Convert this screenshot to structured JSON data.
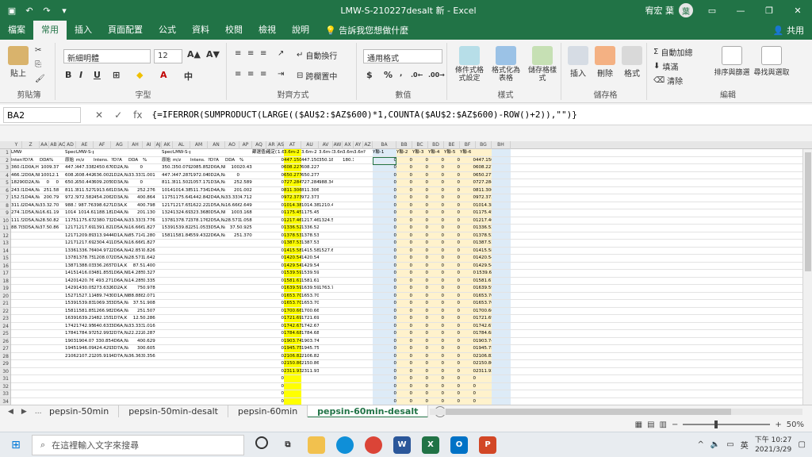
{
  "title_bar": {
    "document_title": "LMW-S-210227desalt 新 - Excel",
    "user_name": "宥宏 葉",
    "avatar_initial": "葉",
    "autosave_icon": "save-icon"
  },
  "menu": {
    "tabs": [
      "檔案",
      "常用",
      "插入",
      "頁面配置",
      "公式",
      "資料",
      "校閱",
      "檢視",
      "說明"
    ],
    "active_tab": "常用",
    "tell_me": "告訴我您想做什麼",
    "share": "共用"
  },
  "ribbon": {
    "clipboard": {
      "paste": "貼上",
      "label": "剪貼簿"
    },
    "font": {
      "name": "新細明體",
      "size": "12",
      "label": "字型",
      "bold": "B",
      "italic": "I",
      "underline": "U",
      "phonetic": "中"
    },
    "alignment": {
      "wrap": "自動換行",
      "merge": "跨欄置中",
      "label": "對齊方式"
    },
    "number": {
      "format": "通用格式",
      "label": "數值",
      "currency": "$",
      "percent": "%"
    },
    "styles": {
      "conditional": "條件式格式設定",
      "table": "格式化為表格",
      "cell_styles": "儲存格樣式",
      "label": "樣式"
    },
    "cells": {
      "insert": "插入",
      "delete": "刪除",
      "format": "格式",
      "label": "儲存格"
    },
    "editing": {
      "autosum": "自動加總",
      "fill": "填滿",
      "clear": "清除",
      "sort": "排序與篩選",
      "find": "尋找與選取",
      "label": "編輯"
    }
  },
  "formula_bar": {
    "name_box": "BA2",
    "formula": "{=IFERROR(SUMPRODUCT(LARGE(($AU$2:$AZ$600)*1,COUNTA($AU$2:$AZ$600)-ROW()+2)),\"\")}"
  },
  "columns": [
    "Y",
    "Z",
    "AA",
    "AB",
    "AC",
    "AD",
    "AE",
    "AF",
    "AG",
    "AH",
    "AI",
    "AJ",
    "AK",
    "AL",
    "AM",
    "AN",
    "AO",
    "AP",
    "AQ",
    "AR",
    "AS",
    "AT",
    "AU",
    "AV",
    "AW",
    "AX",
    "AY",
    "AZ",
    "BA",
    "BB",
    "BC",
    "BD",
    "BE",
    "BF",
    "BG",
    "BH"
  ],
  "rows": [
    [
      "LMW-S-pepsin-ReAD.B-60min-desalt-4",
      "",
      "",
      "",
      "",
      "Spectrum",
      "LMW-S-pepsin-ReAD.B-60min-desalt-5",
      "",
      "",
      "",
      "",
      "",
      "Spectrum",
      "LMW-S-pepsin-ReAD.B-60min-desalt-6",
      "",
      "",
      "",
      "",
      "篩選值(1=有)",
      "確定(1=有)",
      "1.6m",
      "3.6m-2",
      "3.6m-2",
      "3.6m-3",
      "3.6m-4",
      "3.6m-5",
      "3.6m-6",
      "?",
      "Y聯-1",
      "Y聯-2",
      "Y聯-3",
      "Y聯-4",
      "Y聯-5",
      "Y聯-6",
      ""
    ],
    [
      "Intens.",
      "?D?A",
      "DDA",
      "%",
      "",
      "原始",
      "m/z",
      "Intens.",
      "?D?A",
      "DDA",
      "%",
      "",
      "原始",
      "m/z",
      "Intens.",
      "?D?A",
      "DDA",
      "%",
      "",
      "",
      "0",
      "447.15053",
      "447.15053",
      "350.182",
      "",
      "180.13",
      "",
      "",
      "0",
      "0",
      "0",
      "0",
      "0",
      "0",
      "447.1505"
    ],
    [
      "360.051",
      "1D0A,H",
      "100",
      "9.37259",
      "",
      "447.159",
      "447.338",
      "2450.67",
      "0D2A,Na",
      "0",
      "",
      "",
      "350.182",
      "350.079",
      "2085.85",
      "2D0A,NH",
      "100",
      "20.4399",
      "",
      "",
      "0",
      "608.22734",
      "608.22734",
      "",
      "",
      "",
      "",
      "",
      "0",
      "0",
      "0",
      "0",
      "0",
      "0",
      "608.2273"
    ],
    [
      "466.141",
      "2D0A,NH",
      "100",
      "12.1863",
      "",
      "608.227",
      "608.442",
      "636.002",
      "1D2A,Na",
      "33.3333",
      "1.00124",
      "",
      "447.159",
      "447.287",
      "1972.04",
      "0D2A,Na",
      "0",
      "",
      "",
      "",
      "0",
      "650.27736",
      "650.27736",
      "",
      "",
      "",
      "",
      "",
      "0",
      "0",
      "0",
      "0",
      "0",
      "0",
      "650.2774"
    ],
    [
      "1829.85",
      "0D2A,Na",
      "0",
      "0",
      "",
      "650.277",
      "650.443",
      "609.205",
      "0D3A,Na",
      "0",
      "",
      "",
      "811.306",
      "811.502",
      "1057.17",
      "1D3A,Na",
      "25",
      "2.58989",
      "",
      "",
      "0",
      "727.28448",
      "727.28448",
      "988.348",
      "",
      "",
      "",
      "",
      "0",
      "0",
      "0",
      "0",
      "0",
      "0",
      "727.2845"
    ],
    [
      "243.997",
      "1D4A,Na",
      "25",
      "1.58789",
      "",
      "811.306",
      "811.527",
      "1913.66",
      "1D3A,Na",
      "25",
      "2.27691",
      "",
      "1014.38",
      "1014.38",
      "511.734",
      "1D4A,Na",
      "20",
      "1.00293",
      "",
      "",
      "0",
      "811.30616",
      "811.30616",
      "",
      "",
      "",
      "",
      "",
      "0",
      "0",
      "0",
      "0",
      "0",
      "0",
      "811.3062"
    ],
    [
      "152.555",
      "1D4A,Na",
      "20",
      "0.79424",
      "",
      "972.374",
      "972.582",
      "454.206",
      "2D3A,Na",
      "40",
      "0.86468",
      "",
      "1175.45",
      "1175.64",
      "1442.84",
      "2D4A,Na",
      "33.3333",
      "4.71296",
      "",
      "",
      "0",
      "972.37387",
      "972.37387",
      "",
      "",
      "",
      "",
      "",
      "0",
      "0",
      "0",
      "0",
      "0",
      "0",
      "972.3739"
    ],
    [
      "311.869",
      "2D4A,Na",
      "33.3333",
      "2.70611",
      "",
      "988.348",
      "987.76",
      "398.627",
      "1D3A,K",
      "40",
      "0.79887",
      "",
      "1217.46",
      "1217.65",
      "1622.22",
      "1D5A,Na",
      "16.6667",
      "2.64945",
      "",
      "",
      "0",
      "1014.385",
      "1014.385",
      "1210.49",
      "",
      "",
      "",
      "",
      "0",
      "0",
      "0",
      "0",
      "0",
      "0",
      "1014.385"
    ],
    [
      "274.76",
      "1D5A,Na",
      "16.6667",
      "1.19206",
      "",
      "1014.38",
      "1014.6",
      "1188.18",
      "1D4A,Na",
      "20",
      "1.13097",
      "",
      "1324.59",
      "1324.69",
      "323.368",
      "0D5A,NH",
      "100",
      "3.16879",
      "",
      "",
      "0",
      "1175.4527",
      "1175.4527",
      "",
      "",
      "",
      "",
      "",
      "0",
      "0",
      "0",
      "0",
      "0",
      "0",
      "1175.453"
    ],
    [
      "111.527",
      "2D5A,Na",
      "28.5714",
      "0.82949",
      "",
      "1175.45",
      "1175.67",
      "2380.73",
      "2D4A,Na",
      "33.3333",
      "3.77685",
      "",
      "1378.53",
      "1378.72",
      "378.176",
      "2D5A,Na",
      "28.5714",
      "1.05882",
      "",
      "",
      "0",
      "1217.4638",
      "1217.4638",
      "1324.59",
      "",
      "",
      "",
      "",
      "0",
      "0",
      "0",
      "0",
      "0",
      "0",
      "1217.464"
    ],
    [
      "88.7843",
      "3D5A,Na",
      "37.5",
      "0.86669",
      "",
      "1217.46",
      "1217.69",
      "1391.82",
      "1D5A,Na",
      "16.6667",
      "1.82789",
      "",
      "1539.6",
      "1539.82",
      "251.053",
      "3D5A,Na",
      "37.5",
      "0.92586",
      "",
      "",
      "0",
      "1336.521",
      "1336.521",
      "",
      "",
      "",
      "",
      "",
      "0",
      "0",
      "0",
      "0",
      "0",
      "0",
      "1336.521"
    ],
    [
      "",
      "",
      "",
      "",
      "",
      "1217.49",
      "1209.89",
      "313.944",
      "4D1A,Na",
      "85.7143",
      "1.2807",
      "",
      "1581.61",
      "1581.84",
      "559.432",
      "2D6A,Na",
      "25",
      "1.37051",
      "",
      "",
      "0",
      "1378.5315",
      "1378.5315",
      "",
      "",
      "",
      "",
      "",
      "0",
      "0",
      "0",
      "0",
      "0",
      "0",
      "1378.532"
    ],
    [
      "",
      "",
      "",
      "",
      "",
      "1217.46",
      "1217.69",
      "2304.41",
      "1D5A,Na",
      "16.6667",
      "1.82789",
      "",
      "",
      "",
      "",
      "",
      "",
      "",
      "",
      "",
      "0",
      "1387.5315",
      "1387.5315",
      "",
      "",
      "",
      "",
      "",
      "0",
      "0",
      "0",
      "0",
      "0",
      "0",
      "1387.531"
    ],
    [
      "",
      "",
      "",
      "",
      "",
      "1336.52",
      "1336.76",
      "404.972",
      "2D6A,Na",
      "42.8571",
      "0.82602",
      "",
      "",
      "",
      "",
      "",
      "",
      "",
      "",
      "",
      "0",
      "1415.5867",
      "1415.5867",
      "1527.67",
      "",
      "",
      "",
      "",
      "0",
      "0",
      "0",
      "0",
      "0",
      "0",
      "1415.587"
    ],
    [
      "",
      "",
      "",
      "",
      "",
      "1378.53",
      "1378.75",
      "1208.07",
      "2D5A,Na",
      "28.5714",
      "1.64273",
      "",
      "",
      "",
      "",
      "",
      "",
      "",
      "",
      "",
      "0",
      "1420.5426",
      "1420.5426",
      "",
      "",
      "",
      "",
      "",
      "0",
      "0",
      "0",
      "0",
      "0",
      "0",
      "1420.543"
    ],
    [
      "",
      "",
      "",
      "",
      "",
      "1387.53",
      "1388.03",
      "336.265",
      "7D1A,K",
      "87.5",
      "1.40033",
      "",
      "",
      "",
      "",
      "",
      "",
      "",
      "",
      "",
      "0",
      "1429.542",
      "1429.542",
      "",
      "",
      "",
      "",
      "",
      "0",
      "0",
      "0",
      "0",
      "0",
      "0",
      "1429.542"
    ],
    [
      "",
      "",
      "",
      "",
      "",
      "1415.59",
      "1416.03",
      "481.855",
      "1D6A,NH",
      "14.2857",
      "0.32761",
      "",
      "",
      "",
      "",
      "",
      "",
      "",
      "",
      "",
      "0",
      "1539.5998",
      "1539.5998",
      "",
      "",
      "",
      "",
      "",
      "0",
      "0",
      "0",
      "0",
      "0",
      "0",
      "1539.6"
    ],
    [
      "",
      "",
      "",
      "",
      "",
      "1420.54",
      "1420.76",
      "493.27",
      "1D6A,Na",
      "14.2857",
      "0.33537",
      "",
      "",
      "",
      "",
      "",
      "",
      "",
      "",
      "",
      "0",
      "1581.6103",
      "1581.6103",
      "",
      "",
      "",
      "",
      "",
      "0",
      "0",
      "0",
      "0",
      "0",
      "0",
      "1581.61"
    ],
    [
      "",
      "",
      "",
      "",
      "",
      "1429.54",
      "1430.05",
      "273.632",
      "6D2A,K",
      "75",
      "0.97879",
      "",
      "",
      "",
      "",
      "",
      "",
      "",
      "",
      "",
      "0",
      "1639.5948",
      "1639.5948",
      "1763.71",
      "",
      "",
      "",
      "",
      "0",
      "0",
      "0",
      "0",
      "0",
      "0",
      "1639.595"
    ],
    [
      "",
      "",
      "",
      "",
      "",
      "1527.67",
      "1527.11",
      "489.743",
      "0D1A,NH",
      "88.8889",
      "2.07185",
      "",
      "",
      "",
      "",
      "",
      "",
      "",
      "",
      "",
      "0",
      "1653.7021",
      "1653.7021",
      "",
      "",
      "",
      "",
      "",
      "0",
      "0",
      "0",
      "0",
      "0",
      "0",
      "1653.702"
    ],
    [
      "",
      "",
      "",
      "",
      "",
      "1539.6",
      "1539.83",
      "1069.35",
      "3D5A,Na",
      "37.5",
      "1.90851",
      "",
      "",
      "",
      "",
      "",
      "",
      "",
      "",
      "",
      "0",
      "1653.7021",
      "1653.7021",
      "",
      "",
      "",
      "",
      "",
      "0",
      "0",
      "0",
      "0",
      "0",
      "0",
      "1653.702"
    ],
    [
      "",
      "",
      "",
      "",
      "",
      "1581.61",
      "1581.85",
      "1266.98",
      "2D6A,Na",
      "25",
      "1.50748",
      "",
      "",
      "",
      "",
      "",
      "",
      "",
      "",
      "",
      "0",
      "1700.668",
      "1700.668",
      "",
      "",
      "",
      "",
      "",
      "0",
      "0",
      "0",
      "0",
      "0",
      "0",
      "1700.668"
    ],
    [
      "",
      "",
      "",
      "",
      "",
      "1639.59",
      "1639.21",
      "482.155",
      "1D7A,K",
      "12.5",
      "0.28684",
      "",
      "",
      "",
      "",
      "",
      "",
      "",
      "",
      "",
      "0",
      "1721.6967",
      "1721.6967",
      "",
      "",
      "",
      "",
      "",
      "0",
      "0",
      "0",
      "0",
      "0",
      "0",
      "1721.697"
    ],
    [
      "",
      "",
      "",
      "",
      "",
      "1742.68",
      "1742.95",
      "640.633",
      "3D6A,Na",
      "33.3333",
      "1.01632",
      "",
      "",
      "",
      "",
      "",
      "",
      "",
      "",
      "",
      "0",
      "1742.6786",
      "1742.6786",
      "",
      "",
      "",
      "",
      "",
      "0",
      "0",
      "0",
      "0",
      "0",
      "0",
      "1742.679"
    ],
    [
      "",
      "",
      "",
      "",
      "",
      "1784.69",
      "1784.97",
      "252.993",
      "2D7A,Na",
      "22.2222",
      "0.28757",
      "",
      "",
      "",
      "",
      "",
      "",
      "",
      "",
      "",
      "0",
      "1784.6892",
      "1784.6892",
      "",
      "",
      "",
      "",
      "",
      "0",
      "0",
      "0",
      "0",
      "0",
      "0",
      "1784.689"
    ],
    [
      "",
      "",
      "",
      "",
      "",
      "1903.75",
      "1904.07",
      "330.85",
      "4D6A,Na",
      "40",
      "0.62984",
      "",
      "",
      "",
      "",
      "",
      "",
      "",
      "",
      "",
      "0",
      "1903.7469",
      "1903.7469",
      "",
      "",
      "",
      "",
      "",
      "0",
      "0",
      "0",
      "0",
      "0",
      "0",
      "1903.747"
    ],
    [
      "",
      "",
      "",
      "",
      "",
      "1945.76",
      "1946.09",
      "424.429",
      "3D7A,Na",
      "30",
      "0.60599",
      "",
      "",
      "",
      "",
      "",
      "",
      "",
      "",
      "",
      "0",
      "1945.7574",
      "1945.7574",
      "",
      "",
      "",
      "",
      "",
      "0",
      "0",
      "0",
      "0",
      "0",
      "0",
      "1945.757"
    ],
    [
      "",
      "",
      "",
      "",
      "",
      "2106.83",
      "2107.21",
      "205.919",
      "4D7A,Na",
      "36.3636",
      "0.35637",
      "",
      "",
      "",
      "",
      "",
      "",
      "",
      "",
      "",
      "0",
      "2106.8257",
      "2106.8257",
      "",
      "",
      "",
      "",
      "",
      "0",
      "0",
      "0",
      "0",
      "0",
      "0",
      "2106.826"
    ],
    [
      "",
      "",
      "",
      "",
      "",
      "",
      "",
      "",
      "",
      "",
      "",
      "",
      "",
      "",
      "",
      "",
      "",
      "",
      "",
      "",
      "0",
      "2150.8622",
      "2150.8622",
      "",
      "",
      "",
      "",
      "",
      "0",
      "0",
      "0",
      "0",
      "0",
      "0",
      "2150.862"
    ],
    [
      "",
      "",
      "",
      "",
      "",
      "",
      "",
      "",
      "",
      "",
      "",
      "",
      "",
      "",
      "",
      "",
      "",
      "",
      "",
      "",
      "0",
      "2311.9304",
      "2311.9304",
      "",
      "",
      "",
      "",
      "",
      "0",
      "0",
      "0",
      "0",
      "0",
      "0",
      "2311.93"
    ],
    [
      "",
      "",
      "",
      "",
      "",
      "",
      "",
      "",
      "",
      "",
      "",
      "",
      "",
      "",
      "",
      "",
      "",
      "",
      "",
      "",
      "0",
      "",
      "",
      "",
      "",
      "",
      "",
      "",
      "0",
      "0",
      "0",
      "0",
      "0",
      "0",
      ""
    ],
    [
      "",
      "",
      "",
      "",
      "",
      "",
      "",
      "",
      "",
      "",
      "",
      "",
      "",
      "",
      "",
      "",
      "",
      "",
      "",
      "",
      "0",
      "",
      "",
      "",
      "",
      "",
      "",
      "",
      "0",
      "0",
      "0",
      "0",
      "0",
      "0",
      ""
    ],
    [
      "",
      "",
      "",
      "",
      "",
      "",
      "",
      "",
      "",
      "",
      "",
      "",
      "",
      "",
      "",
      "",
      "",
      "",
      "",
      "",
      "0",
      "",
      "",
      "",
      "",
      "",
      "",
      "",
      "0",
      "0",
      "0",
      "0",
      "0",
      "0",
      ""
    ],
    [
      "",
      "",
      "",
      "",
      "",
      "",
      "",
      "",
      "",
      "",
      "",
      "",
      "",
      "",
      "",
      "",
      "",
      "",
      "",
      "",
      "0",
      "",
      "",
      "",
      "",
      "",
      "",
      "",
      "0",
      "0",
      "0",
      "0",
      "0",
      "0",
      ""
    ]
  ],
  "sheets": {
    "tabs": [
      "pepsin-50min",
      "pepsin-50min-desalt",
      "pepsin-60min",
      "pepsin-60min-desalt"
    ],
    "active": "pepsin-60min-desalt",
    "ellipsis": "..."
  },
  "status_bar": {
    "zoom": "50%",
    "minus": "−",
    "plus": "+"
  },
  "taskbar": {
    "search_placeholder": "在這裡輸入文字來搜尋",
    "ime": "英",
    "time": "下午 10:27",
    "date": "2021/3/29",
    "apps": [
      "cortana",
      "task-view",
      "file-explorer",
      "edge",
      "chrome",
      "word",
      "excel",
      "outlook",
      "powerpoint"
    ]
  },
  "colors": {
    "excel_green": "#217346",
    "yellow_highlight": "#ffff00",
    "blue_column": "#ddebf7",
    "orange_column": "#fff2cc"
  }
}
